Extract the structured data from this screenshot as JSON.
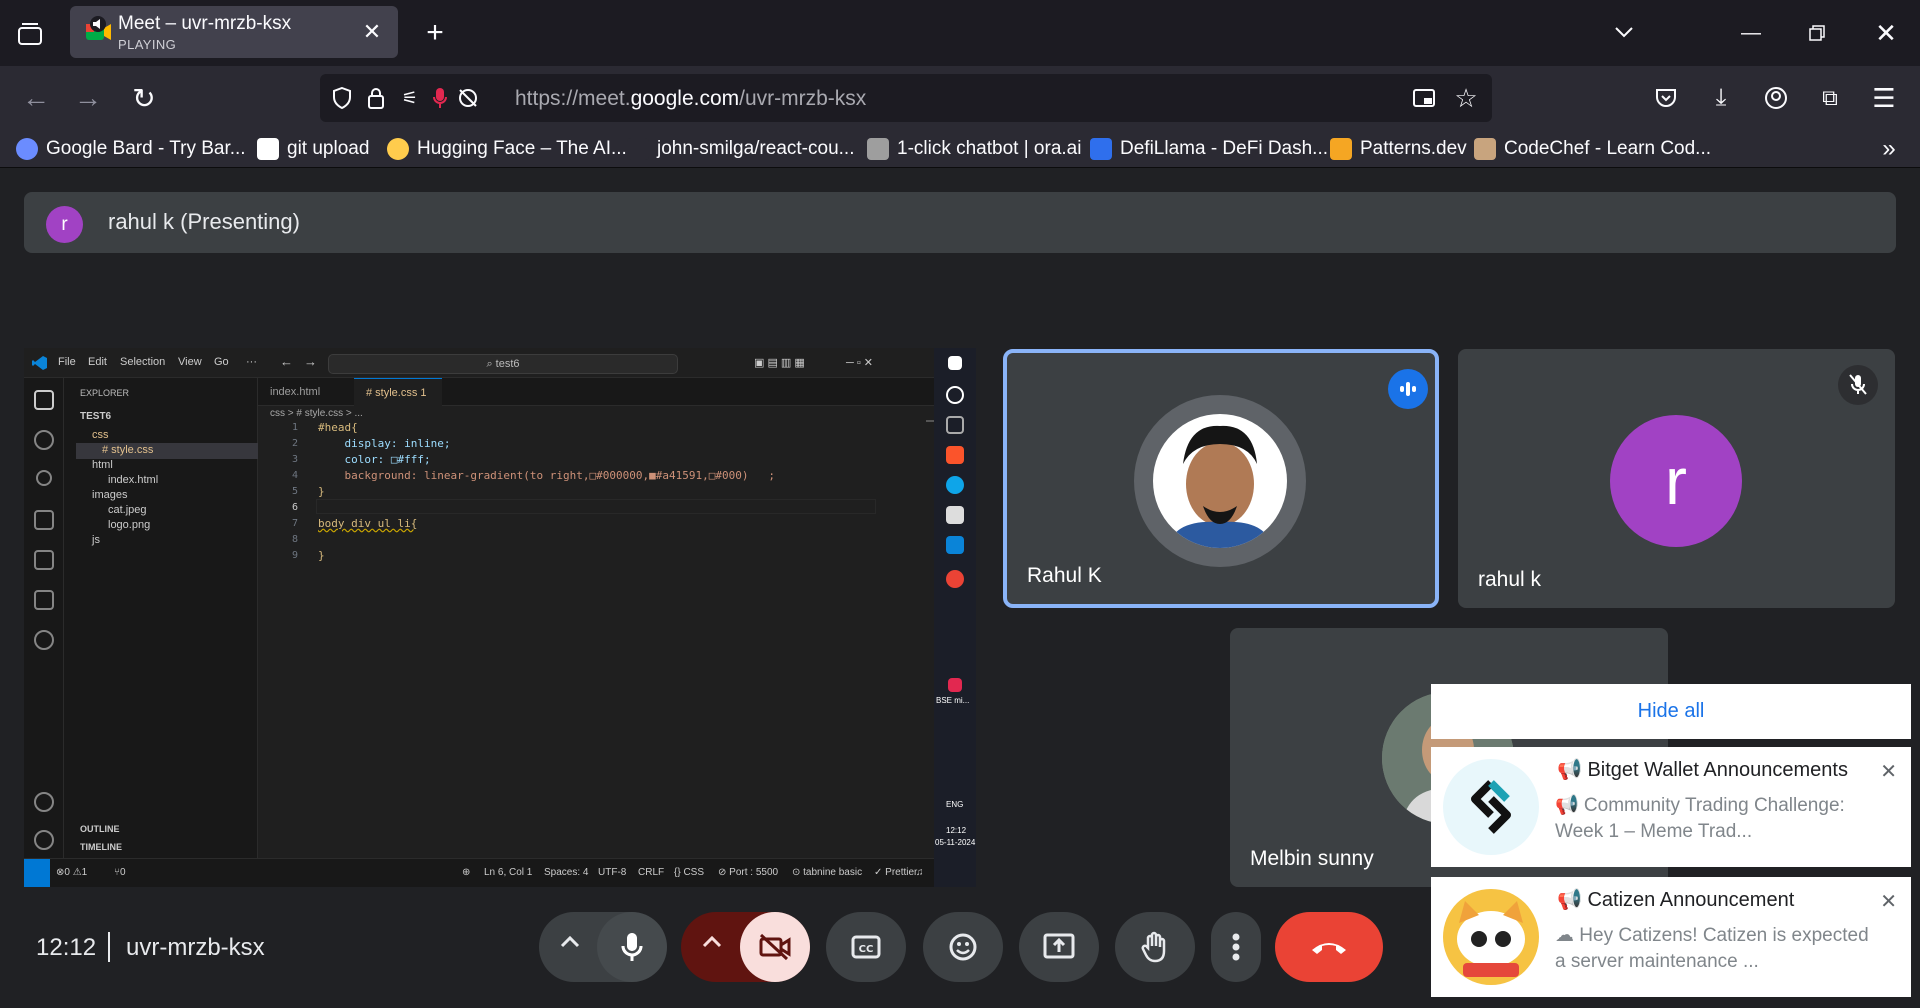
{
  "browser": {
    "tab": {
      "title": "Meet – uvr-mrzb-ksx",
      "status": "PLAYING"
    },
    "url": {
      "prefix": "https://meet.",
      "domain": "google.com",
      "path": "/uvr-mrzb-ksx"
    },
    "bookmarks": [
      {
        "label": "Google Bard - Try Bar...",
        "color": "#6b8cff"
      },
      {
        "label": "git upload",
        "color": "#ffffff"
      },
      {
        "label": "Hugging Face – The AI...",
        "color": "#ffcc4d"
      },
      {
        "label": "john-smilga/react-cou...",
        "color": "#2b2a33"
      },
      {
        "label": "1-click chatbot | ora.ai",
        "color": "#9e9e9e"
      },
      {
        "label": "DefiLlama - DeFi Dash...",
        "color": "#2f6fed"
      },
      {
        "label": "Patterns.dev",
        "color": "#f5a623"
      },
      {
        "label": "CodeChef - Learn Cod...",
        "color": "#c8a47e"
      }
    ]
  },
  "presenting": {
    "initial": "r",
    "label": "rahul k (Presenting)"
  },
  "vscode": {
    "menus": [
      "File",
      "Edit",
      "Selection",
      "View",
      "Go",
      "···"
    ],
    "search": "⌕ test6",
    "explorer_title": "EXPLORER",
    "tree": [
      {
        "label": "TEST6"
      },
      {
        "label": "css"
      },
      {
        "label": "# style.css"
      },
      {
        "label": "html"
      },
      {
        "label": "index.html"
      },
      {
        "label": "images"
      },
      {
        "label": "cat.jpeg"
      },
      {
        "label": "logo.png"
      },
      {
        "label": "js"
      }
    ],
    "outline": "OUTLINE",
    "timeline": "TIMELINE",
    "tabs": [
      "index.html",
      "# style.css 1"
    ],
    "breadcrumb": "css > # style.css > ...",
    "lines": [
      {
        "n": "1",
        "text": "#head{"
      },
      {
        "n": "2",
        "text": "    display: inline;"
      },
      {
        "n": "3",
        "text": "    color: □#fff;"
      },
      {
        "n": "4",
        "text": "    background: linear-gradient(to right,□#000000,■#a41591,□#000)   ;"
      },
      {
        "n": "5",
        "text": "}"
      },
      {
        "n": "6",
        "text": ""
      },
      {
        "n": "7",
        "text": "body div ul li{"
      },
      {
        "n": "8",
        "text": ""
      },
      {
        "n": "9",
        "text": "}"
      }
    ],
    "status": {
      "problems": "⊗0 ⚠1",
      "ports_left": "⑂0",
      "position": "Ln 6, Col 1",
      "spaces": "Spaces: 4",
      "encoding": "UTF-8",
      "eol": "CRLF",
      "lang": "{} CSS",
      "port": "⊘ Port : 5500",
      "tabnine": "⊙ tabnine basic",
      "prettier": "✓ Prettier"
    },
    "taskbar": {
      "bse": "BSE mi...",
      "lang": "ENG",
      "time": "12:12",
      "date": "05-11-2024"
    }
  },
  "participants": [
    {
      "name": "Rahul K",
      "speaking": true
    },
    {
      "name": "rahul k",
      "initial": "r",
      "muted": true
    },
    {
      "name": "Melbin sunny"
    }
  ],
  "notifications": {
    "hide_all": "Hide all",
    "items": [
      {
        "title": "📢 Bitget Wallet Announcements",
        "body": "📢 Community Trading Challenge: Week 1 – Meme Trad..."
      },
      {
        "title": "📢 Catizen Announcement",
        "body": "☁ Hey Catizens!  Catizen is expected a server maintenance ..."
      }
    ]
  },
  "meeting": {
    "time": "12:12",
    "code": "uvr-mrzb-ksx"
  },
  "colors": {
    "accent": "#8ab4f8",
    "avatar": "#a142c4",
    "end_call": "#ea4335",
    "cam_off": "#f9dedc"
  }
}
